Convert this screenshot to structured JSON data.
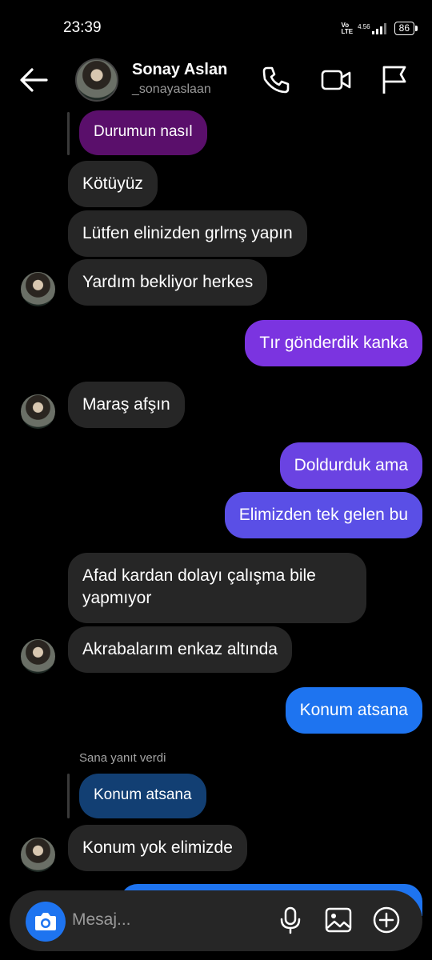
{
  "status_bar": {
    "time": "23:39",
    "network_top": "Vo",
    "network_bottom": "LTE",
    "speed": "4.56",
    "battery": "86"
  },
  "header": {
    "name": "Sonay Aslan",
    "username": "_sonayaslaan"
  },
  "messages": [
    {
      "text": "Durumun nasıl"
    },
    {
      "text": "Kötüyüz"
    },
    {
      "text": "Lütfen elinizden grlrnş yapın"
    },
    {
      "text": "Yardım bekliyor herkes"
    },
    {
      "text": "Tır gönderdik kanka"
    },
    {
      "text": "Maraş afşın"
    },
    {
      "text": "Doldurduk ama"
    },
    {
      "text": "Elimizden tek gelen bu"
    },
    {
      "text": "Afad kardan dolayı çalışma bile yapmıyor"
    },
    {
      "text": "Akrabalarım enkaz altında"
    },
    {
      "text": "Konum atsana"
    },
    {
      "text": "Konum atsana"
    },
    {
      "text": "Konum yok elimizde"
    }
  ],
  "reply_label": "Sana yanıt verdi",
  "composer": {
    "placeholder": "Mesaj..."
  },
  "colors": {
    "background": "#000000",
    "received": "#262626",
    "sent_blue": "#1e74f0",
    "sent_purple": "#7b34e0"
  }
}
